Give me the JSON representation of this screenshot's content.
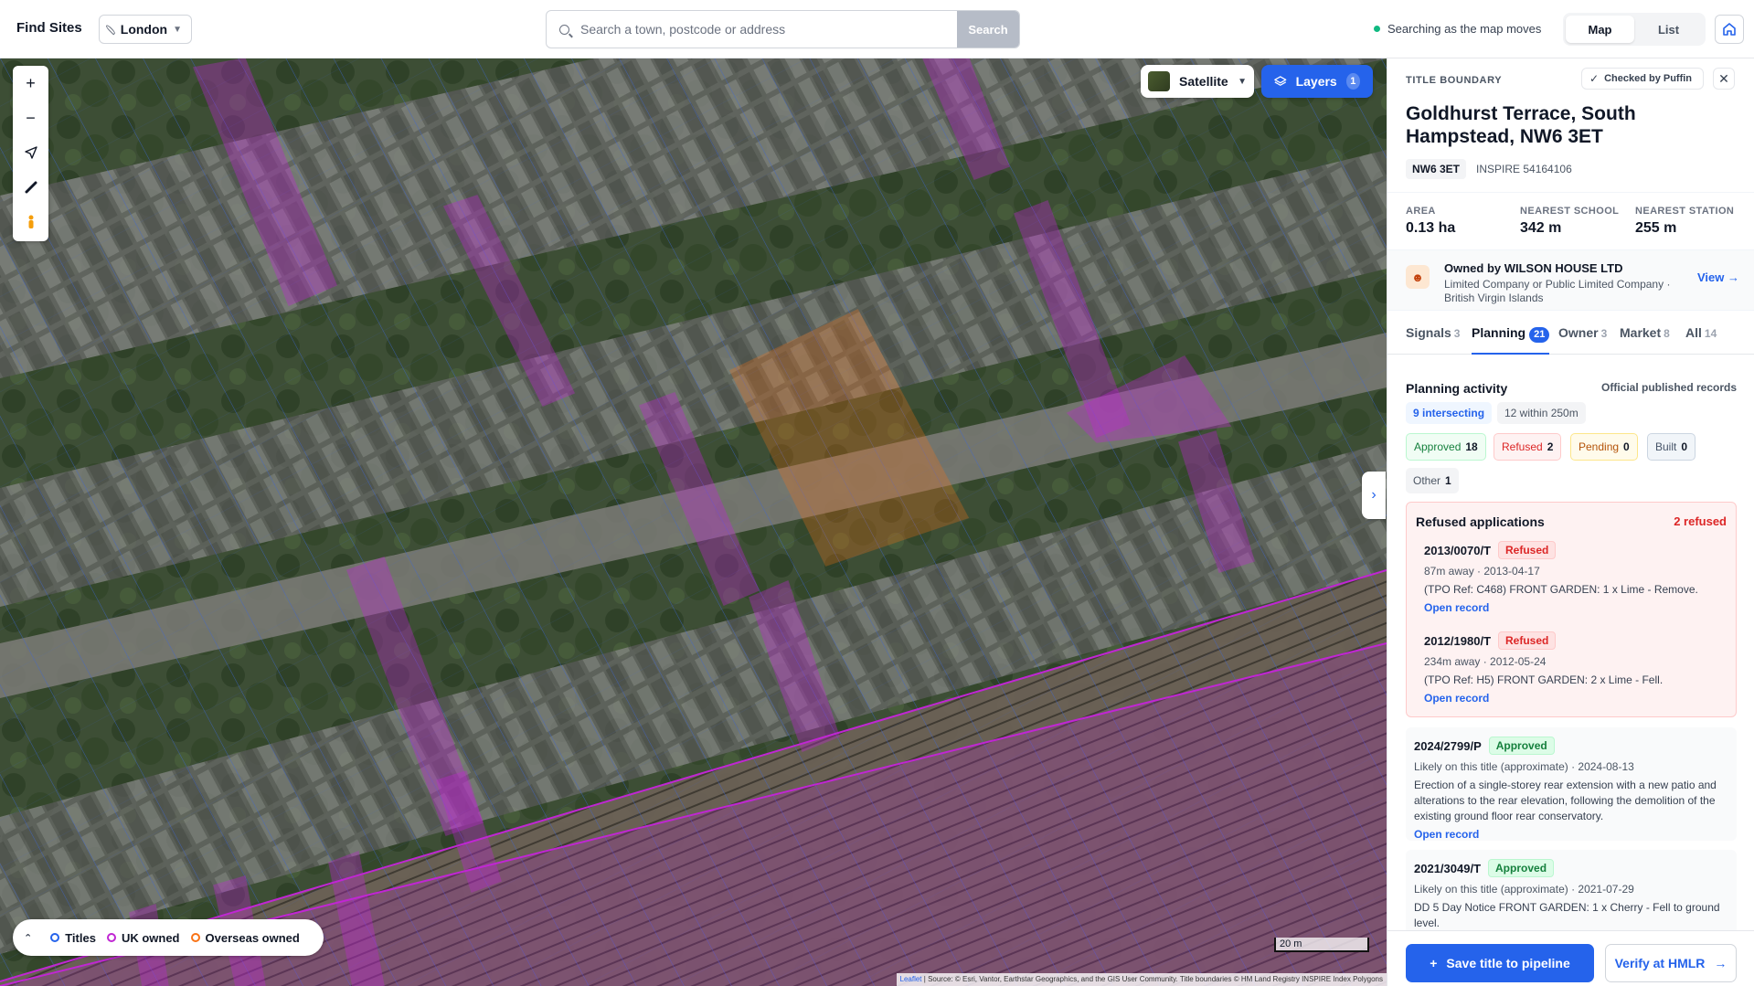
{
  "header": {
    "brand": "Find Sites",
    "location": "London",
    "search_placeholder": "Search a town, postcode or address",
    "search_button": "Search",
    "status": "Searching as the map moves",
    "view_map": "Map",
    "view_list": "List"
  },
  "map": {
    "basemap_label": "Satellite",
    "layers_label": "Layers",
    "layers_count": "1",
    "legend": {
      "titles": "Titles",
      "uk_owned": "UK owned",
      "overseas_owned": "Overseas owned"
    },
    "scale": "20 m",
    "attribution_leaflet": "Leaflet",
    "attribution": "| Source: © Esri, Vantor, Earthstar Geographics, and the GIS User Community. Title boundaries © HM Land Registry INSPIRE Index Polygons",
    "colors": {
      "titles": "#2563eb",
      "uk_owned": "#c026d3",
      "overseas_owned": "#f97316"
    }
  },
  "panel": {
    "section_label": "TITLE BOUNDARY",
    "checked_by": "Checked by Puffin",
    "title": "Goldhurst Terrace, South Hampstead, NW6 3ET",
    "postcode": "NW6 3ET",
    "inspire": "INSPIRE 54164106",
    "stats": [
      {
        "label": "AREA",
        "value": "0.13 ha"
      },
      {
        "label": "NEAREST SCHOOL",
        "value": "342 m"
      },
      {
        "label": "NEAREST STATION",
        "value": "255 m"
      }
    ],
    "owner": {
      "name": "Owned by WILSON HOUSE LTD",
      "detail": "Limited Company or Public Limited Company · British Virgin Islands",
      "view": "View →"
    },
    "tabs": [
      {
        "label": "Signals",
        "count": "3"
      },
      {
        "label": "Planning",
        "count": "21"
      },
      {
        "label": "Owner",
        "count": "3"
      },
      {
        "label": "Market",
        "count": "8"
      },
      {
        "label": "All",
        "count": "14"
      }
    ],
    "planning": {
      "title": "Planning activity",
      "official": "Official published records",
      "intersecting": "9 intersecting",
      "within": "12 within 250m",
      "approved_label": "Approved",
      "approved": "18",
      "refused_label": "Refused",
      "refused": "2",
      "pending_label": "Pending",
      "pending": "0",
      "built_label": "Built",
      "built": "0",
      "other_label": "Other",
      "other": "1",
      "refused_box_title": "Refused applications",
      "refused_box_count": "2 refused",
      "open_record": "Open record",
      "records": [
        {
          "ref": "2013/0070/T",
          "status": "Refused",
          "meta": "87m away · 2013-04-17",
          "desc": "(TPO Ref: C468) FRONT GARDEN: 1 x Lime - Remove."
        },
        {
          "ref": "2012/1980/T",
          "status": "Refused",
          "meta": "234m away · 2012-05-24",
          "desc": "(TPO Ref: H5) FRONT GARDEN: 2 x Lime - Fell."
        },
        {
          "ref": "2024/2799/P",
          "status": "Approved",
          "meta": "Likely on this title (approximate) · 2024-08-13",
          "desc": "Erection of a single-storey rear extension with a new patio and alterations to the rear elevation, following the demolition of the existing ground floor rear conservatory."
        },
        {
          "ref": "2021/3049/T",
          "status": "Approved",
          "meta": "Likely on this title (approximate) · 2021-07-29",
          "desc": "DD 5 Day Notice FRONT GARDEN: 1 x Cherry - Fell to ground level."
        }
      ]
    },
    "save_button": "Save title to pipeline",
    "verify_button": "Verify at HMLR"
  }
}
